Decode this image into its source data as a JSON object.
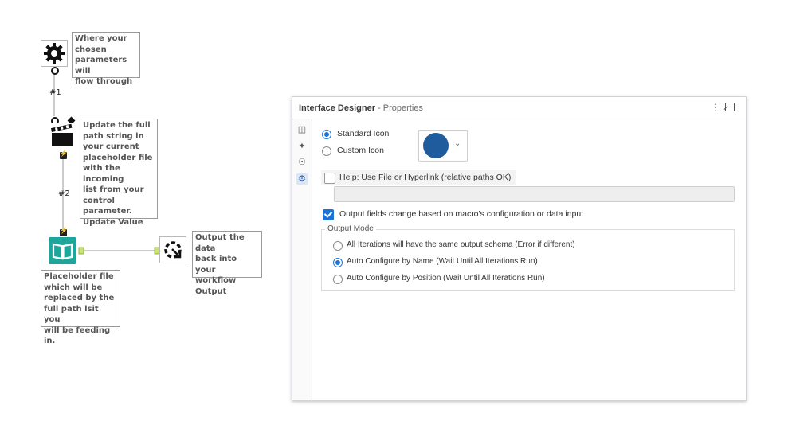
{
  "workflow": {
    "notes": {
      "params": "Where your\nchosen\nparameters will\nflow through",
      "update": "Update the full\npath string in\nyour current\nplaceholder file\nwith the incoming\nlist from your\ncontrol parameter.\nUpdate Value",
      "placeholder": "Placeholder file\nwhich will be\nreplaced by the\nfull path lsit you\nwill be feeding in.",
      "output": "Output the data\nback into your\nworkflow\nOutput"
    },
    "connection_labels": {
      "c1": "#1",
      "c2": "#2"
    },
    "tools": {
      "control_param": "gear-icon",
      "action": "clapperboard-icon",
      "input": "book-icon",
      "macro_output": "macro-output-icon"
    }
  },
  "panel": {
    "title": "Interface Designer",
    "subtitle": " - Properties",
    "header_menu_icon": "vertical-ellipsis-icon",
    "header_dock_icon": "undock-icon",
    "rail_icons": [
      "layout-icon",
      "magic-wand-icon",
      "tree-icon",
      "gear-icon"
    ],
    "icon": {
      "standard_label": "Standard Icon",
      "custom_label": "Custom Icon",
      "selected": "standard",
      "swatch_color": "#1f5c9e"
    },
    "help": {
      "label": "Help: Use File or Hyperlink (relative paths OK)",
      "checked": false,
      "value": ""
    },
    "output_fields": {
      "label": "Output fields change based on macro's configuration or data input",
      "checked": true
    },
    "output_mode": {
      "legend": "Output Mode",
      "options": [
        "All Iterations will have the same output schema (Error if different)",
        "Auto Configure by Name (Wait Until All Iterations Run)",
        "Auto Configure by Position (Wait Until All Iterations Run)"
      ],
      "selected_index": 1
    },
    "accent_color": "#1a73d9"
  }
}
